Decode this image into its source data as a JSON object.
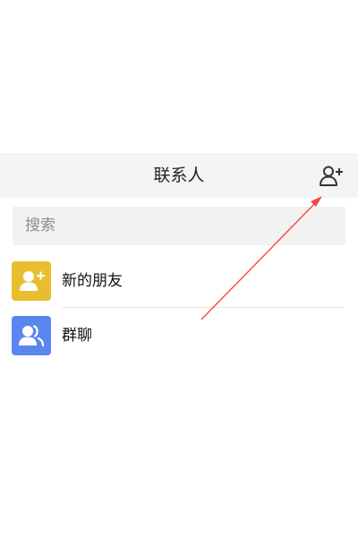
{
  "header": {
    "title": "联系人"
  },
  "search": {
    "placeholder": "搜索"
  },
  "items": [
    {
      "label": "新的朋友",
      "icon": "add-user-icon",
      "color": "#E8BE2E"
    },
    {
      "label": "群聊",
      "icon": "group-icon",
      "color": "#5B86F0"
    }
  ],
  "annotation": {
    "arrow_color": "#F0474A"
  }
}
